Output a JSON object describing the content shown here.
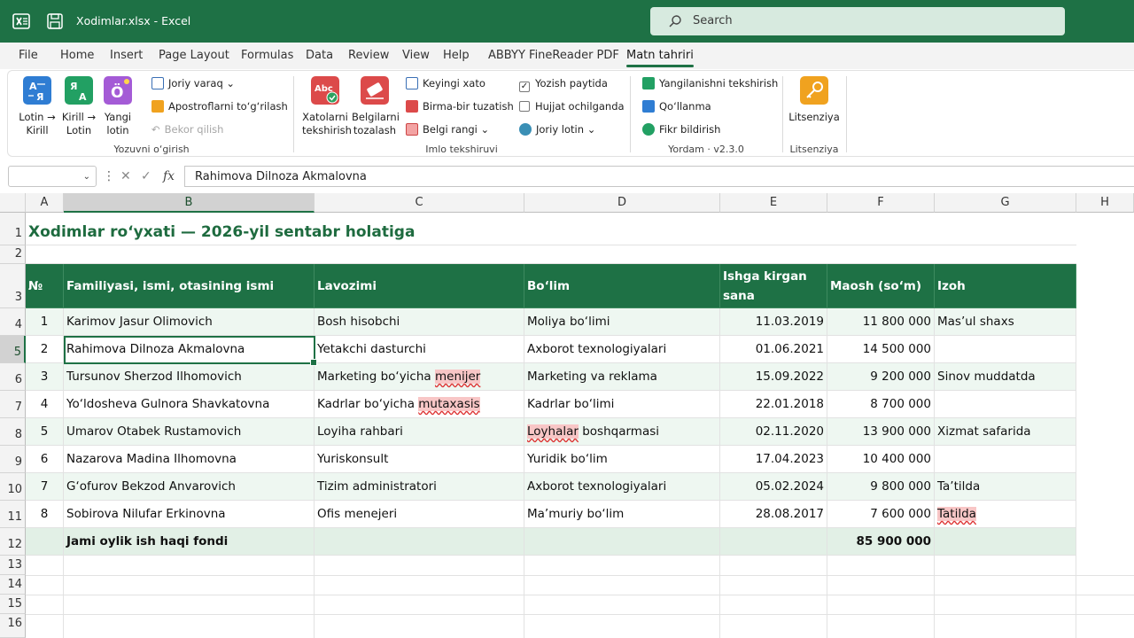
{
  "window": {
    "title": "Xodimlar.xlsx - Excel",
    "search_placeholder": "Search",
    "accent": "#1e7145"
  },
  "tabs": [
    "File",
    "Home",
    "Insert",
    "Page Layout",
    "Formulas",
    "Data",
    "Review",
    "View",
    "Help",
    "ABBYY FineReader PDF",
    "Matn tahriri"
  ],
  "active_tab": "Matn tahriri",
  "ribbon": {
    "group_transliteration": {
      "name": "Yozuvni o‘girish",
      "latin_to_cyr": [
        "Lotin →",
        "Kirill"
      ],
      "cyr_to_latin": [
        "Kirill →",
        "Lotin"
      ],
      "new_latin": [
        "Yangi",
        "lotin"
      ],
      "current_spelling": "Joriy varaq",
      "fix_apostrophes": "Apostroflarni to‘g‘rilash",
      "undo": "Bekor qilish"
    },
    "group_spell": {
      "name": "Imlo tekshiruvi",
      "check_errors": [
        "Xatolarni",
        "tekshirish"
      ],
      "clear_marks": [
        "Belgilarni",
        "tozalash"
      ],
      "next_error": "Keyingi xato",
      "fix_one": "Birma-bir tuzatish",
      "mark_color": "Belgi rangi",
      "check_while_typing": "Yozish paytida",
      "doc_clean": "Hujjat ochilganda",
      "current_latin": "Joriy lotin"
    },
    "group_help": {
      "name": "Yordam · v2.3.0",
      "updates": "Yangilanishni tekshirish",
      "manual": "Qo‘llanma",
      "feedback": "Fikr bildirish"
    },
    "group_license": {
      "name": "Litsenziya",
      "button": "Litsenziya"
    }
  },
  "formula_bar": {
    "name_box": "",
    "content": "Rahimova Dilnoza Akmalovna"
  },
  "columns": [
    "A",
    "B",
    "C",
    "D",
    "E",
    "F",
    "G",
    "H"
  ],
  "rows": [
    "1",
    "2",
    "3",
    "4",
    "5",
    "6",
    "7",
    "8",
    "9",
    "10",
    "11",
    "12",
    "13",
    "14",
    "15",
    "16"
  ],
  "sheet": {
    "title": "Xodimlar ro‘yxati — 2026-yil sentabr holatiga",
    "headers": [
      "№",
      "Familiyasi, ismi, otasining ismi",
      "Lavozimi",
      "Bo‘lim",
      "Ishga kirgan sana",
      "Maosh (so‘m)",
      "Izoh"
    ],
    "header_e": [
      "Ishga kirgan",
      "sana"
    ],
    "records": [
      {
        "n": "1",
        "name": "Karimov Jasur Olimovich",
        "pos": "Bosh hisobchi",
        "dept": "Moliya bo‘limi",
        "date": "11.03.2019",
        "salary": "11 800 000",
        "note": "Mas’ul shaxs"
      },
      {
        "n": "2",
        "name": "Rahimova Dilnoza Akmalovna",
        "pos": "Yetakchi dasturchi",
        "dept": "Axborot texnologiyalari",
        "date": "01.06.2021",
        "salary": "14 500 000",
        "note": ""
      },
      {
        "n": "3",
        "name": "Tursunov Sherzod Ilhomovich",
        "pos": "Marketing bo‘yicha ",
        "pos_err": "menijer",
        "dept": "Marketing va reklama",
        "date": "15.09.2022",
        "salary": "9 200 000",
        "note": "Sinov muddatda"
      },
      {
        "n": "4",
        "name": "Yo‘ldosheva Gulnora Shavkatovna",
        "pos": "Kadrlar bo‘yicha ",
        "pos_err": "mutaxasis",
        "dept": "Kadrlar bo‘limi",
        "date": "22.01.2018",
        "salary": "8 700 000",
        "note": ""
      },
      {
        "n": "5",
        "name": "Umarov Otabek Rustamovich",
        "pos": "Loyiha rahbari",
        "dept_err": "Loyhalar",
        "dept": " boshqarmasi",
        "date": "02.11.2020",
        "salary": "13 900 000",
        "note": "Xizmat safarida"
      },
      {
        "n": "6",
        "name": "Nazarova Madina Ilhomovna",
        "pos": "Yuriskonsult",
        "dept": "Yuridik bo‘lim",
        "date": "17.04.2023",
        "salary": "10 400 000",
        "note": ""
      },
      {
        "n": "7",
        "name": "G‘ofurov Bekzod Anvarovich",
        "pos": "Tizim administratori",
        "dept": "Axborot texnologiyalari",
        "date": "05.02.2024",
        "salary": "9 800 000",
        "note": "Ta’tilda"
      },
      {
        "n": "8",
        "name": "Sobirova Nilufar Erkinovna",
        "pos": "Ofis menejeri",
        "dept": "Ma’muriy bo‘lim",
        "date": "28.08.2017",
        "salary": "7 600 000",
        "note_err": "Tatilda",
        "note": ""
      }
    ],
    "total_label": "Jami oylik ish haqi fondi",
    "total_value": "85 900 000"
  }
}
